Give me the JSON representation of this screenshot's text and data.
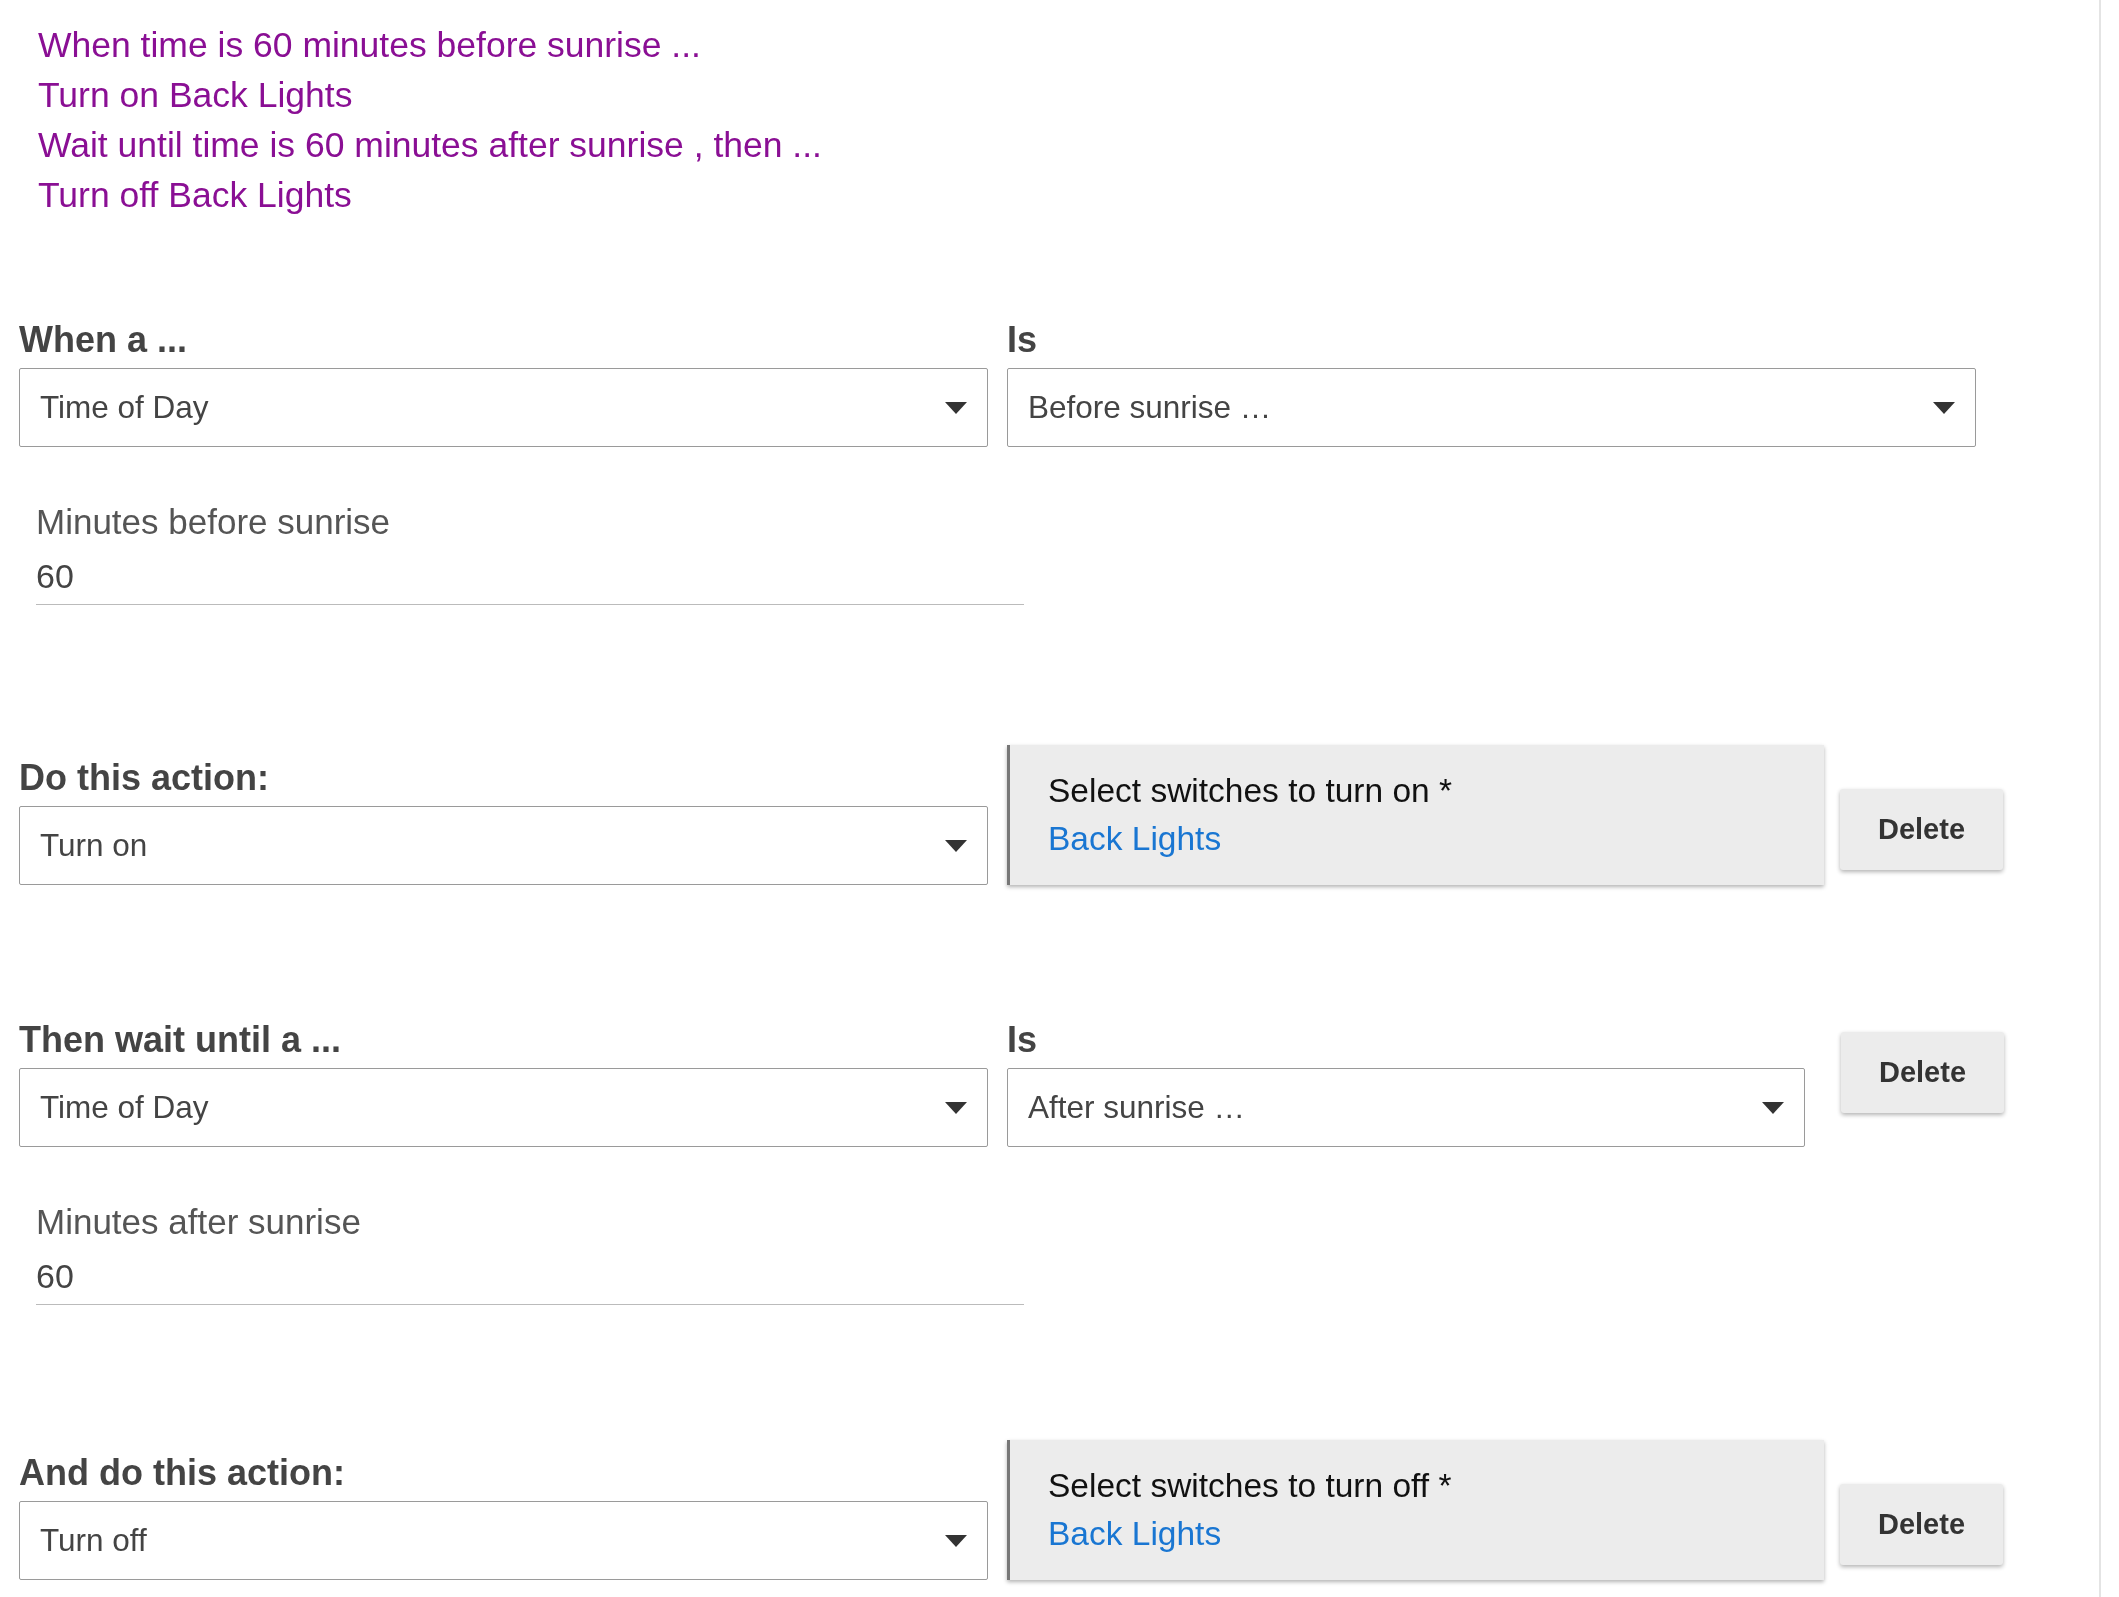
{
  "summary": [
    "When time is 60 minutes before sunrise ...",
    "Turn on Back Lights",
    "Wait until time is 60 minutes after sunrise , then ...",
    "Turn off Back Lights"
  ],
  "sections": [
    {
      "kind": "condition",
      "label": "When a ...",
      "subject": "Time of Day",
      "is_label": "Is",
      "state": "Before sunrise …",
      "field": {
        "label": "Minutes before sunrise",
        "value": "60"
      }
    },
    {
      "kind": "action",
      "label": "Do this action:",
      "action": "Turn on",
      "card": {
        "title": "Select switches to turn on *",
        "device": "Back Lights"
      },
      "button": "Delete"
    },
    {
      "kind": "wait",
      "label": "Then wait until a ...",
      "subject": "Time of Day",
      "is_label": "Is",
      "state": "After sunrise …",
      "button": "Delete",
      "field": {
        "label": "Minutes after sunrise",
        "value": "60"
      }
    },
    {
      "kind": "action",
      "label": "And do this action:",
      "action": "Turn off",
      "card": {
        "title": "Select switches to turn off *",
        "device": "Back Lights"
      },
      "button": "Delete"
    }
  ]
}
